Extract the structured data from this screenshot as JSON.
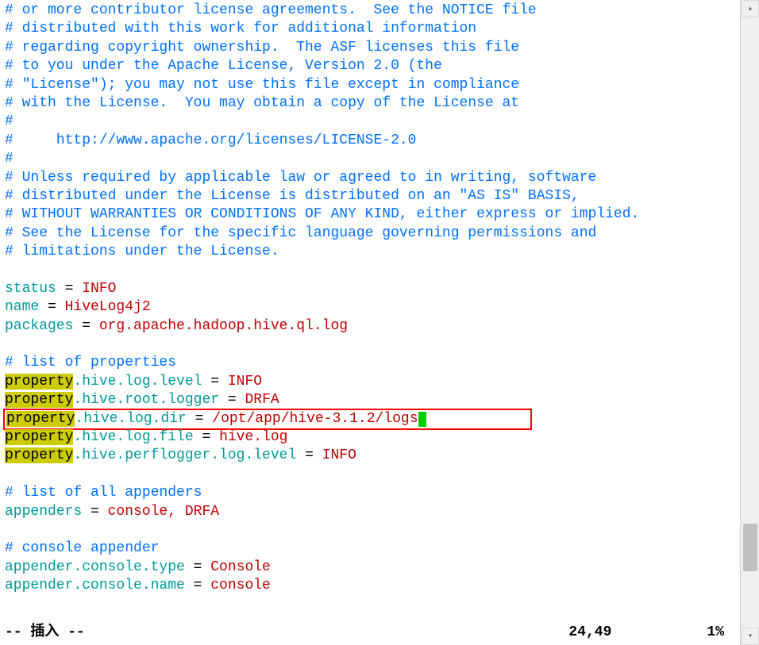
{
  "license": {
    "l1": "# or more contributor license agreements.  See the NOTICE file",
    "l2": "# distributed with this work for additional information",
    "l3": "# regarding copyright ownership.  The ASF licenses this file",
    "l4": "# to you under the Apache License, Version 2.0 (the",
    "l5": "# \"License\"); you may not use this file except in compliance",
    "l6": "# with the License.  You may obtain a copy of the License at",
    "l7": "#",
    "l8a": "#     ",
    "l8b": "http://www.apache.org/licenses/LICENSE-2.0",
    "l9": "#",
    "l10": "# Unless required by applicable law or agreed to in writing, software",
    "l11": "# distributed under the License is distributed on an \"AS IS\" BASIS,",
    "l12": "# WITHOUT WARRANTIES OR CONDITIONS OF ANY KIND, either express or implied.",
    "l13": "# See the License for the specific language governing permissions and",
    "l14": "# limitations under the License."
  },
  "kv": {
    "status_k": "status",
    "status_v": "INFO",
    "name_k": "name",
    "name_v": "HiveLog4j2",
    "packages_k": "packages",
    "packages_v": "org.apache.hadoop.hive.ql.log"
  },
  "props_header": "# list of properties",
  "prop_word": "property",
  "props": {
    "p1_path": ".hive.log.level",
    "p1_val": "INFO",
    "p2_path": ".hive.root.logger",
    "p2_val": "DRFA",
    "p3_path": ".hive.log.dir",
    "p3_val": "/opt/app/hive-3.1.2/logs",
    "p4_path": ".hive.log.file",
    "p4_val": "hive.log",
    "p5_path": ".hive.perflogger.log.level",
    "p5_val": "INFO"
  },
  "appenders_header": "# list of all appenders",
  "appenders": {
    "k": "appenders",
    "v": "console, DRFA"
  },
  "console_header": "# console appender",
  "console": {
    "type_k": "appender.console.type",
    "type_v": "Console",
    "name_k": "appender.console.name",
    "name_v": "console"
  },
  "status": {
    "mode": "-- 插入 --",
    "pos": "24,49",
    "pct": "1%"
  },
  "eq": " = "
}
